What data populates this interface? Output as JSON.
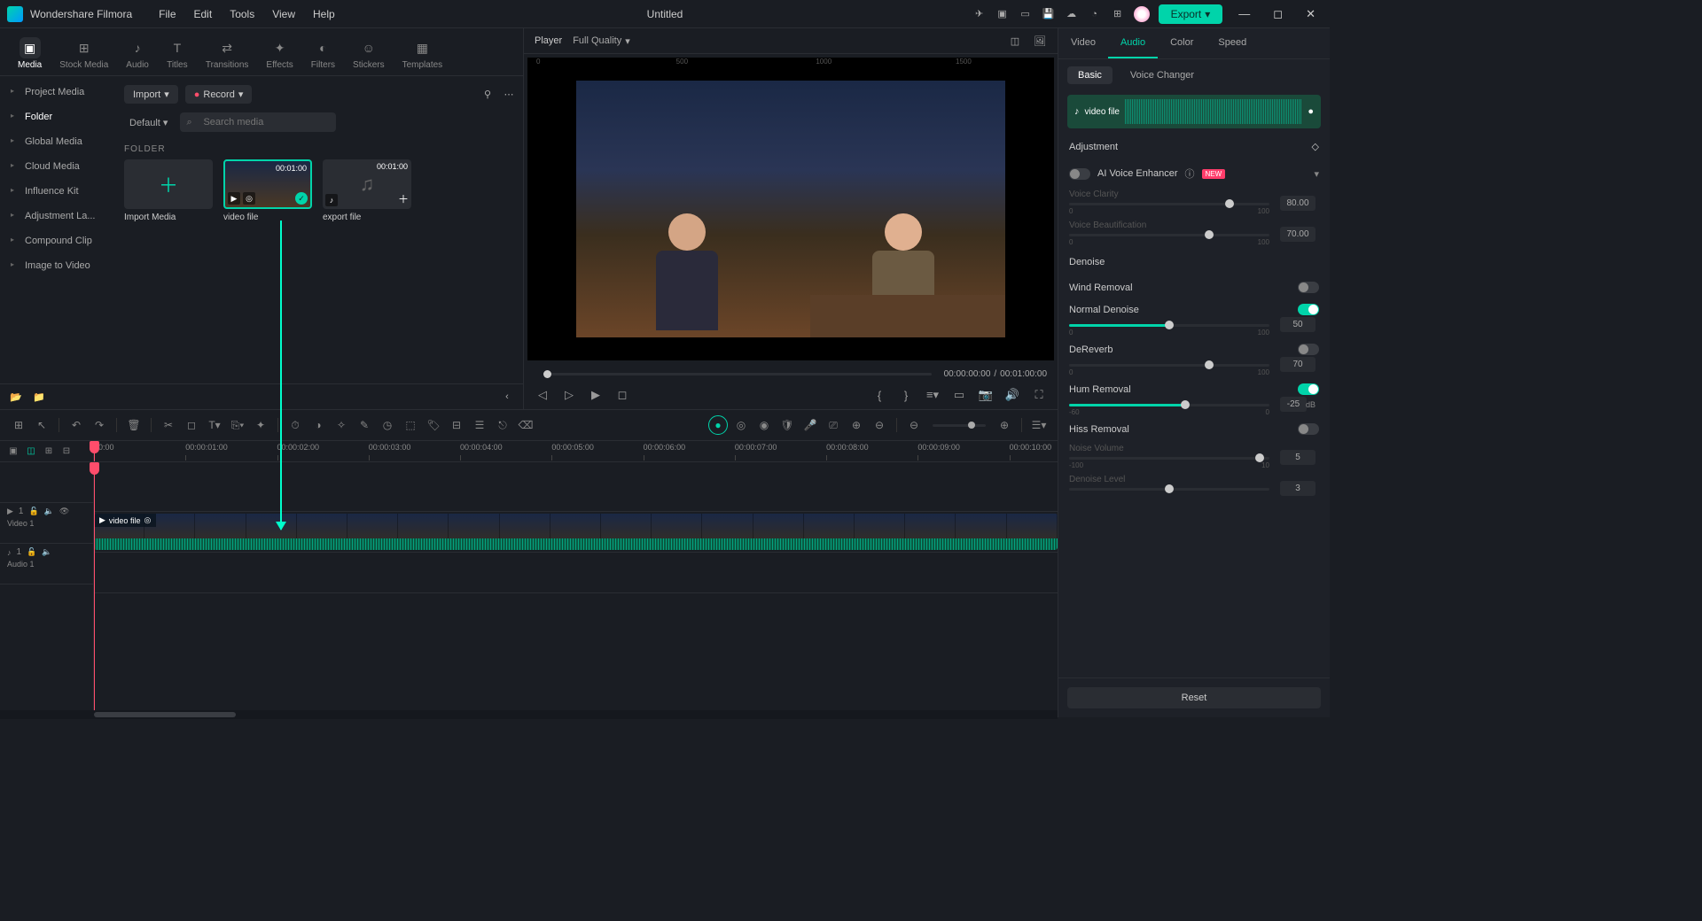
{
  "app": {
    "name": "Wondershare Filmora",
    "title": "Untitled",
    "export": "Export"
  },
  "menu": [
    "File",
    "Edit",
    "Tools",
    "View",
    "Help"
  ],
  "categories": [
    {
      "id": "media",
      "label": "Media",
      "icon": "▣"
    },
    {
      "id": "stock",
      "label": "Stock Media",
      "icon": "⊞"
    },
    {
      "id": "audio",
      "label": "Audio",
      "icon": "♪"
    },
    {
      "id": "titles",
      "label": "Titles",
      "icon": "T"
    },
    {
      "id": "transitions",
      "label": "Transitions",
      "icon": "⇄"
    },
    {
      "id": "effects",
      "label": "Effects",
      "icon": "✦"
    },
    {
      "id": "filters",
      "label": "Filters",
      "icon": "◐"
    },
    {
      "id": "stickers",
      "label": "Stickers",
      "icon": "☺"
    },
    {
      "id": "templates",
      "label": "Templates",
      "icon": "▦"
    }
  ],
  "sidebar": [
    "Project Media",
    "Folder",
    "Global Media",
    "Cloud Media",
    "Influence Kit",
    "Adjustment La...",
    "Compound Clip",
    "Image to Video"
  ],
  "media": {
    "import": "Import",
    "record": "Record",
    "sort": "Default",
    "search_ph": "Search media",
    "folder_label": "FOLDER",
    "items": [
      {
        "label": "Import Media",
        "type": "add"
      },
      {
        "label": "video file",
        "type": "video",
        "dur": "00:01:00",
        "selected": true
      },
      {
        "label": "export file",
        "type": "audio",
        "dur": "00:01:00"
      }
    ]
  },
  "player": {
    "label": "Player",
    "quality": "Full Quality",
    "cur": "00:00:00:00",
    "sep": "/",
    "total": "00:01:00:00",
    "ruler": [
      "0",
      "500",
      "1000",
      "1500"
    ]
  },
  "inspector": {
    "tabs": [
      "Video",
      "Audio",
      "Color",
      "Speed"
    ],
    "subtabs": [
      "Basic",
      "Voice Changer"
    ],
    "clip_name": "video file",
    "adjustment": "Adjustment",
    "ai_enhancer": "AI Voice Enhancer",
    "new": "NEW",
    "voice_clarity": {
      "label": "Voice Clarity",
      "val": "80.00",
      "min": "0",
      "max": "100"
    },
    "voice_beaut": {
      "label": "Voice Beautification",
      "val": "70.00",
      "min": "0",
      "max": "100"
    },
    "denoise": "Denoise",
    "wind": "Wind Removal",
    "normal": {
      "label": "Normal Denoise",
      "val": "50",
      "min": "0",
      "max": "100"
    },
    "dereverb": {
      "label": "DeReverb",
      "val": "70",
      "min": "0",
      "max": "100"
    },
    "hum": {
      "label": "Hum Removal",
      "val": "-25",
      "unit": "dB",
      "min": "-60",
      "max": "0"
    },
    "hiss": {
      "label": "Hiss Removal"
    },
    "noise_vol": {
      "label": "Noise Volume",
      "val": "5",
      "min": "-100",
      "max": "10"
    },
    "denoise_lvl": {
      "label": "Denoise Level",
      "val": "3",
      "min": "1",
      "max": "5"
    },
    "reset": "Reset"
  },
  "timeline": {
    "ticks": [
      "00:00",
      "00:00:01:00",
      "00:00:02:00",
      "00:00:03:00",
      "00:00:04:00",
      "00:00:05:00",
      "00:00:06:00",
      "00:00:07:00",
      "00:00:08:00",
      "00:00:09:00",
      "00:00:10:00"
    ],
    "tracks": {
      "video": "Video 1",
      "audio": "Audio 1"
    },
    "clip": "video file"
  }
}
